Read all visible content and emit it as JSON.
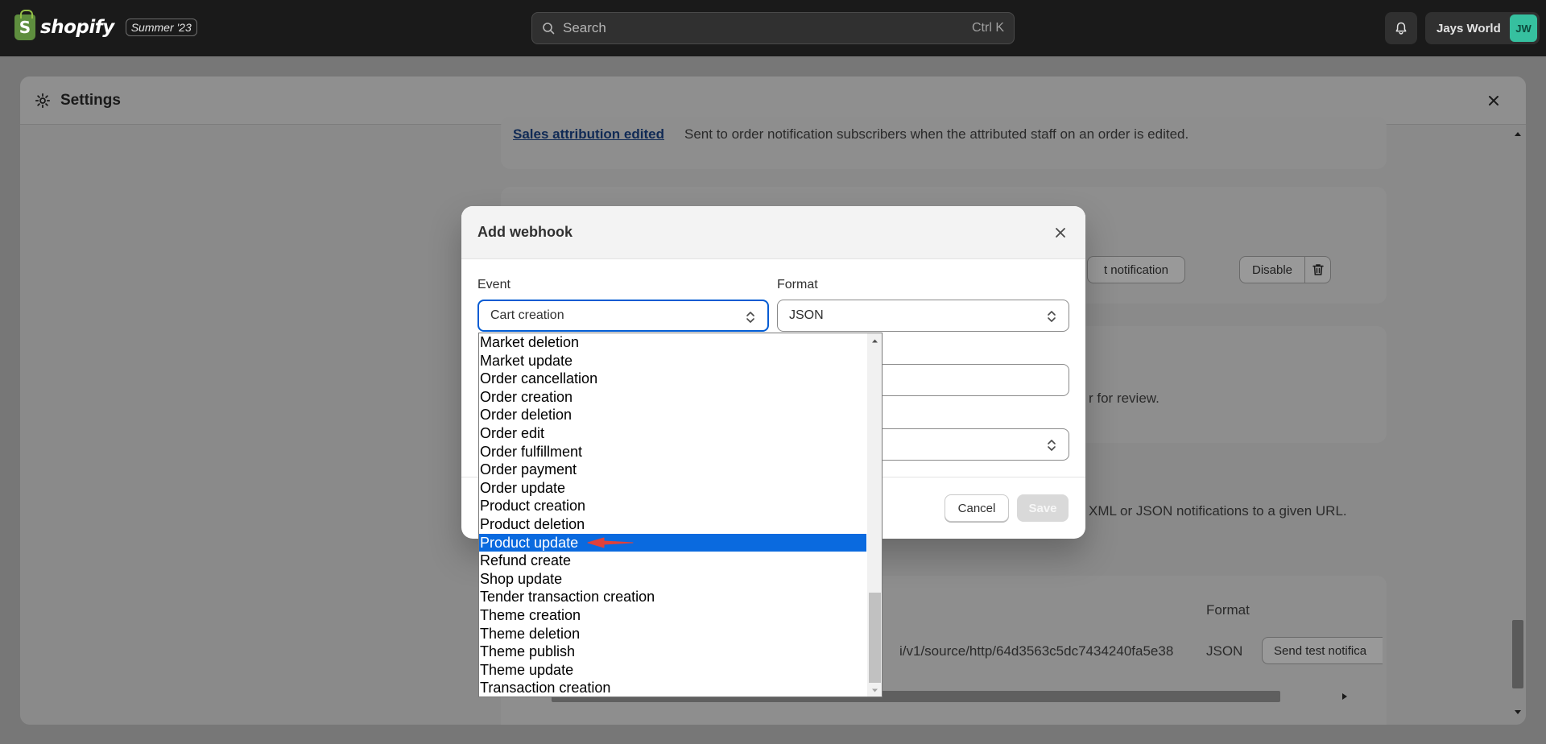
{
  "topbar": {
    "brand": "shopify",
    "edition_badge": "Summer '23",
    "search_placeholder": "Search",
    "search_shortcut": "Ctrl K",
    "store_name": "Jays World",
    "avatar_initials": "JW"
  },
  "settings": {
    "title": "Settings",
    "cards": {
      "sales_attribution_link": "Sales attribution edited",
      "sales_attribution_desc": "Sent to order notification subscribers when the attributed staff on an order is edited.",
      "test_notification_label": "t notification",
      "disable_label": "Disable",
      "review_text": "r for review.",
      "webhooks_desc": "XML or JSON notifications to a given URL.",
      "webhook_table_header_format": "Format",
      "webhook_row_url": "i/v1/source/http/64d3563c5dc7434240fa5e38",
      "webhook_row_format": "JSON",
      "webhook_row_send_test": "Send test notifica"
    }
  },
  "modal": {
    "title": "Add webhook",
    "event_label": "Event",
    "event_value": "Cart creation",
    "format_label": "Format",
    "format_value": "JSON",
    "cancel_label": "Cancel",
    "save_label": "Save"
  },
  "event_options": [
    "Market deletion",
    "Market update",
    "Order cancellation",
    "Order creation",
    "Order deletion",
    "Order edit",
    "Order fulfillment",
    "Order payment",
    "Order update",
    "Product creation",
    "Product deletion",
    "Product update",
    "Refund create",
    "Shop update",
    "Tender transaction creation",
    "Theme creation",
    "Theme deletion",
    "Theme publish",
    "Theme update",
    "Transaction creation"
  ],
  "highlighted_option": "Product update",
  "colors": {
    "highlight": "#0a6adf",
    "focus_ring": "#005bd3",
    "annotation_arrow": "#e0413a"
  }
}
